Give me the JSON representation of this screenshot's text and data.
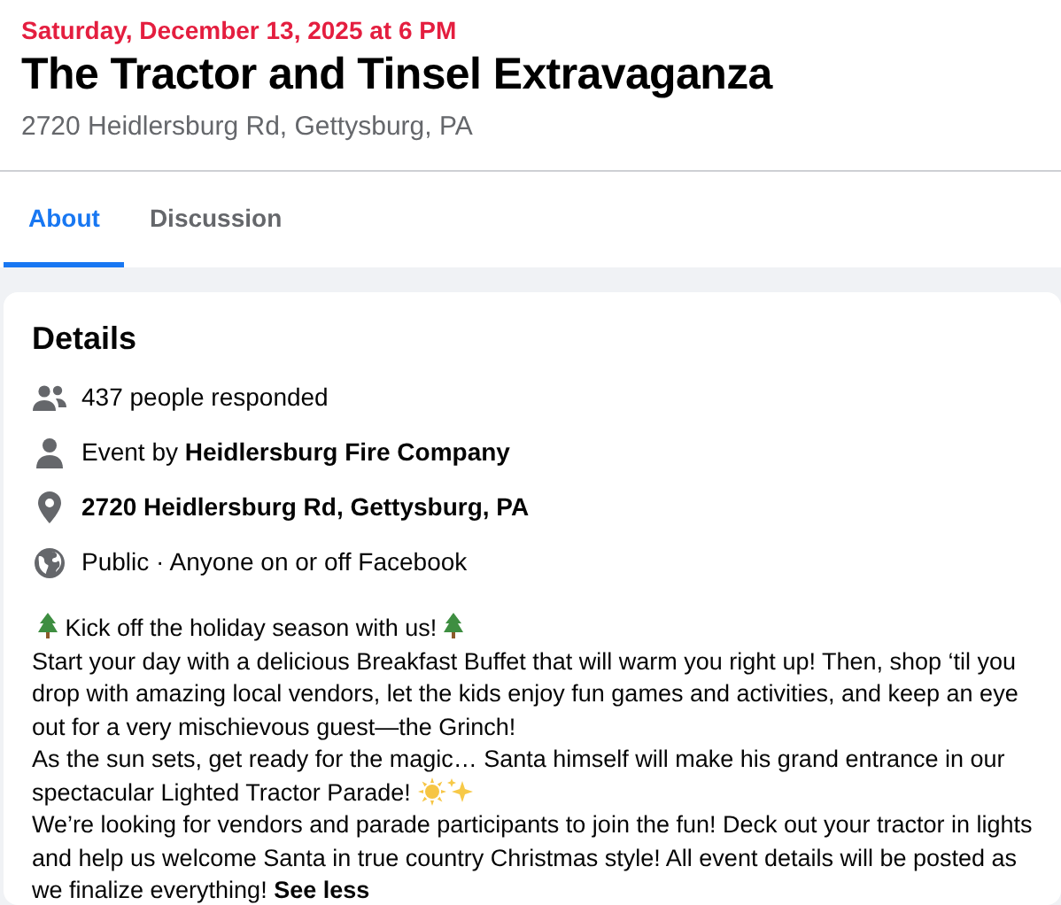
{
  "event": {
    "date": "Saturday, December 13, 2025 at 6 PM",
    "title": "The Tractor and Tinsel Extravaganza",
    "location": "2720 Heidlersburg Rd, Gettysburg, PA"
  },
  "tabs": [
    {
      "label": "About",
      "selected": true
    },
    {
      "label": "Discussion",
      "selected": false
    }
  ],
  "details": {
    "heading": "Details",
    "rows": [
      {
        "kind": "people",
        "text": "437 people responded"
      },
      {
        "kind": "host",
        "text": "Event by **Heidlersburg Fire Company**"
      },
      {
        "kind": "place",
        "text": "**2720 Heidlersburg Rd, Gettysburg, PA**"
      },
      {
        "kind": "privacy",
        "text": "Public · Anyone on or off Facebook"
      }
    ],
    "description": [
      {
        "kind": "trees",
        "text": "Kick off the holiday season with us!"
      },
      {
        "kind": "plain",
        "text": "Start your day with a delicious Breakfast Buffet that will warm you right up! Then, shop ‘til you drop with amazing local vendors, let the kids enjoy fun games and activities, and keep an eye out for a very mischievous guest—the Grinch!"
      },
      {
        "kind": "sparkle",
        "text": "As the sun sets, get ready for the magic… Santa himself will make his grand entrance in our spectacular Lighted Tractor Parade!"
      },
      {
        "kind": "plain",
        "text": "We’re looking for vendors and parade participants to join the fun! Deck out your tractor in lights and help us welcome Santa in true country Christmas style! All event details will be posted as we finalize everything!"
      }
    ],
    "see_less": "See less"
  }
}
